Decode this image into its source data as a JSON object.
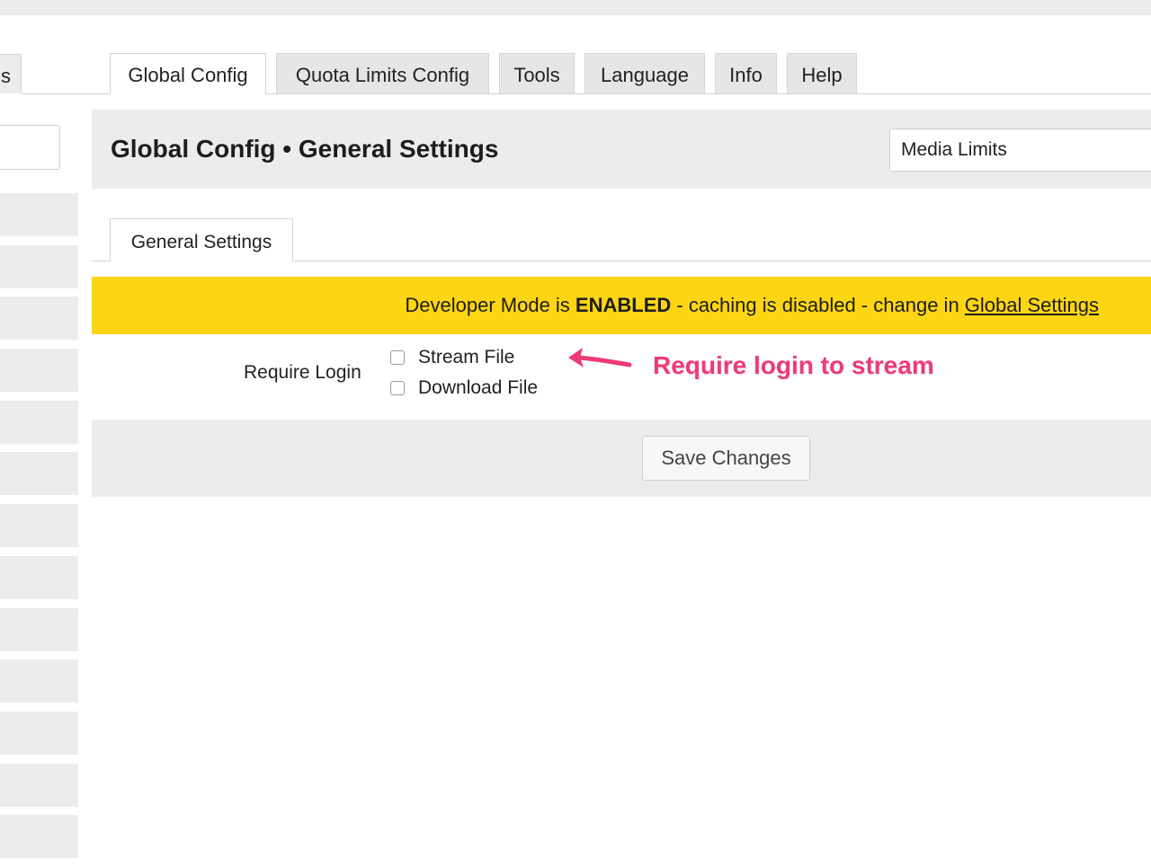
{
  "left_sidebar": {
    "tab_fragment": "s",
    "row_count": 13
  },
  "tabs": [
    {
      "label": "Global Config",
      "active": true
    },
    {
      "label": "Quota Limits Config",
      "active": false
    },
    {
      "label": "Tools",
      "active": false
    },
    {
      "label": "Language",
      "active": false
    },
    {
      "label": "Info",
      "active": false
    },
    {
      "label": "Help",
      "active": false
    }
  ],
  "header": {
    "title": "Global Config • General Settings",
    "select_value": "Media Limits"
  },
  "subtab": {
    "label": "General Settings"
  },
  "notice": {
    "prefix": "Developer Mode is ",
    "emphasis": "ENABLED",
    "suffix": " - caching is disabled - change in ",
    "link": "Global Settings",
    "background_color": "#fdd513"
  },
  "form": {
    "label": "Require Login",
    "options": [
      {
        "label": "Stream File",
        "checked": false
      },
      {
        "label": "Download File",
        "checked": false
      }
    ]
  },
  "annotation": {
    "text": "Require login to stream",
    "color": "#ee3a78"
  },
  "footer": {
    "save_label": "Save Changes"
  }
}
